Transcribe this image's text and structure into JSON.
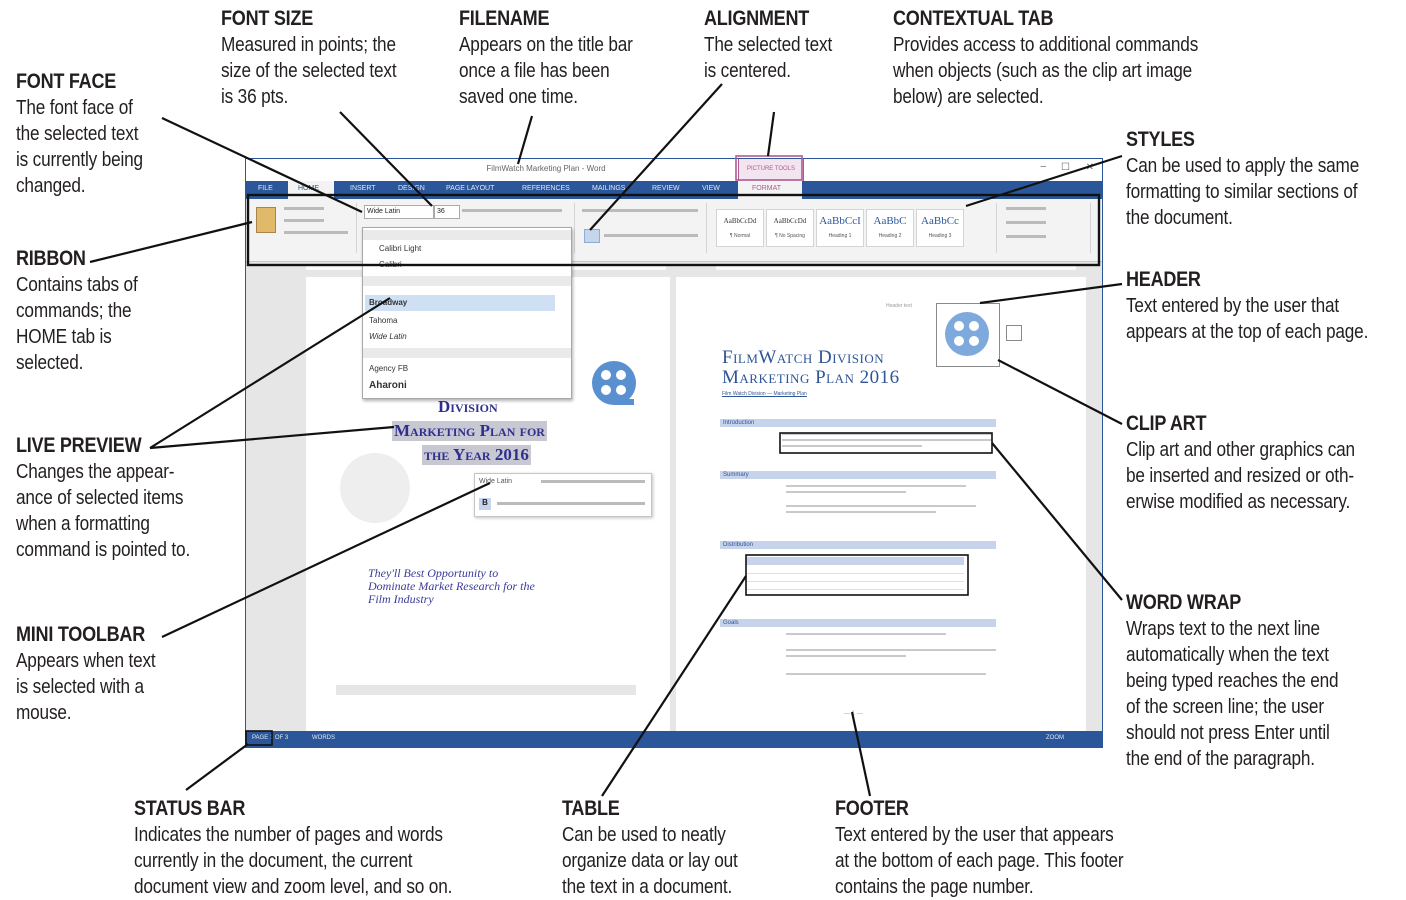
{
  "callouts": {
    "font_face": {
      "title": "FONT FACE",
      "lines": [
        "The font face of",
        "the selected text",
        "is currently being",
        "changed."
      ]
    },
    "font_size": {
      "title": "FONT SIZE",
      "lines": [
        "Measured in points; the",
        "size of the selected text",
        "is 36 pts."
      ]
    },
    "filename": {
      "title": "FILENAME",
      "lines": [
        "Appears on the title bar",
        "once a file has been",
        "saved one time."
      ]
    },
    "alignment": {
      "title": "ALIGNMENT",
      "lines": [
        "The selected text",
        "is centered."
      ]
    },
    "contextual_tab": {
      "title": "CONTEXTUAL TAB",
      "lines": [
        "Provides access to additional commands",
        "when objects (such as the clip art image",
        "below) are selected."
      ]
    },
    "styles": {
      "title": "STYLES",
      "lines": [
        "Can be used to apply the same",
        "formatting to similar sections of",
        "the document."
      ]
    },
    "ribbon": {
      "title": "RIBBON",
      "lines": [
        "Contains tabs of",
        "commands; the",
        "HOME tab is",
        "selected."
      ]
    },
    "header": {
      "title": "HEADER",
      "lines": [
        "Text entered by the user that",
        "appears at the top of each page."
      ]
    },
    "live_preview": {
      "title": "LIVE PREVIEW",
      "lines": [
        "Changes the appear-",
        "ance of selected items",
        "when a formatting",
        "command is pointed to."
      ]
    },
    "clip_art": {
      "title": "CLIP ART",
      "lines": [
        "Clip art and other graphics can",
        "be inserted and resized or oth-",
        "erwise modified as necessary."
      ]
    },
    "mini_toolbar": {
      "title": "MINI TOOLBAR",
      "lines": [
        "Appears when text",
        "is selected with a",
        "mouse."
      ]
    },
    "word_wrap": {
      "title": "WORD WRAP",
      "lines": [
        "Wraps text to the next line",
        "automatically when the text",
        "being typed reaches the end",
        "of the screen line; the user",
        "should not press Enter until",
        "the end of the paragraph."
      ]
    },
    "status_bar": {
      "title": "STATUS BAR",
      "lines": [
        "Indicates the number of pages and words",
        "currently in the document, the current",
        "document view and zoom level, and so on."
      ]
    },
    "table": {
      "title": "TABLE",
      "lines": [
        "Can be used to neatly",
        "organize data or lay out",
        "the text in a document."
      ]
    },
    "footer": {
      "title": "FOOTER",
      "lines": [
        "Text entered by the user that appears",
        "at the bottom of each page. This footer",
        "contains the page number."
      ]
    }
  },
  "word": {
    "tabs": [
      "FILE",
      "HOME",
      "INSERT",
      "DESIGN",
      "PAGE LAYOUT",
      "REFERENCES",
      "MAILINGS",
      "REVIEW",
      "VIEW",
      "FORMAT"
    ],
    "font_box": "Wide Latin",
    "font_size_box": "36",
    "font_list": [
      "Calibri Light",
      "Calibri",
      "Broadway",
      "Tahoma",
      "Wide Latin",
      "Agency FB",
      "Aharoni"
    ],
    "style_samples": [
      "AaBbCcI",
      "AaBbCcI",
      "AaBbC",
      "AaBbC",
      "AaBbCc"
    ],
    "left_page_title": [
      "Division",
      "Marketing Plan for",
      "the Year 2016"
    ],
    "left_page_tagline": [
      "They'll Best Opportunity to",
      "Dominate Market Research for the",
      "Film Industry"
    ],
    "right_page_title": [
      "FilmWatch Division",
      "Marketing Plan 2016"
    ],
    "dropdown_font": "Aharoni"
  }
}
